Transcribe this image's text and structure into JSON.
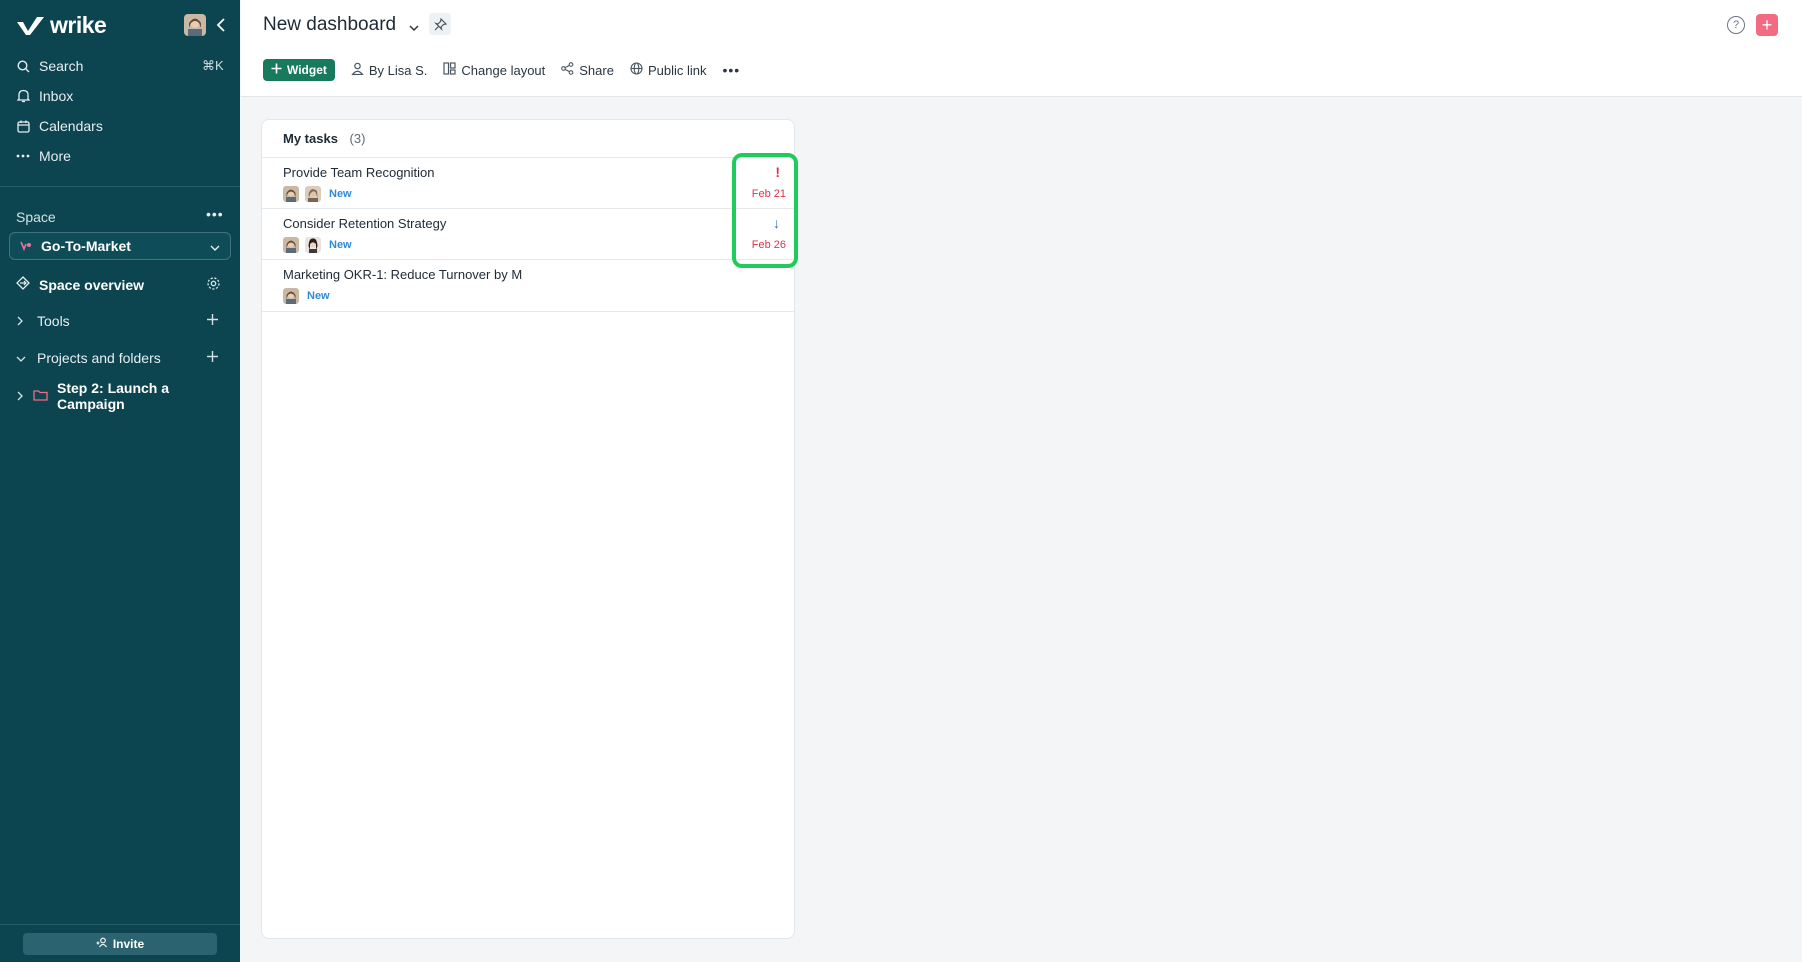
{
  "app": {
    "logo_text": "wrike"
  },
  "sidebar": {
    "nav": [
      {
        "label": "Search",
        "icon": "search-icon"
      },
      {
        "label": "Inbox",
        "icon": "bell-icon"
      },
      {
        "label": "Calendars",
        "icon": "calendar-icon"
      },
      {
        "label": "More",
        "icon": "more-dots-icon"
      }
    ],
    "search_shortcut": "⌘K",
    "space_label": "Space",
    "space_selected": "Go-To-Market",
    "space_overview": "Space overview",
    "tools": "Tools",
    "projects_folders": "Projects and folders",
    "folder_item": "Step 2: Launch a Campaign",
    "invite": "Invite"
  },
  "header": {
    "title": "New dashboard",
    "toolbar": {
      "widget": "Widget",
      "by": "By Lisa S.",
      "change_layout": "Change layout",
      "share": "Share",
      "public_link": "Public link"
    }
  },
  "widget": {
    "title": "My tasks",
    "count": "(3)",
    "tasks": [
      {
        "name": "Provide Team Recognition",
        "status": "New",
        "priority": "!",
        "due": "Feb 21"
      },
      {
        "name": "Consider Retention Strategy",
        "status": "New",
        "priority": "↓",
        "due": "Feb 26"
      },
      {
        "name": "Marketing OKR-1: Reduce Turnover by M",
        "status": "New",
        "priority": "",
        "due": ""
      }
    ]
  },
  "colors": {
    "sidebar_bg": "#0c4550",
    "accent_green": "#187a5c",
    "status_blue": "#2e8ad8",
    "due_red": "#e0334d",
    "highlight": "#1fcb5b",
    "add_pink": "#f26b82"
  }
}
